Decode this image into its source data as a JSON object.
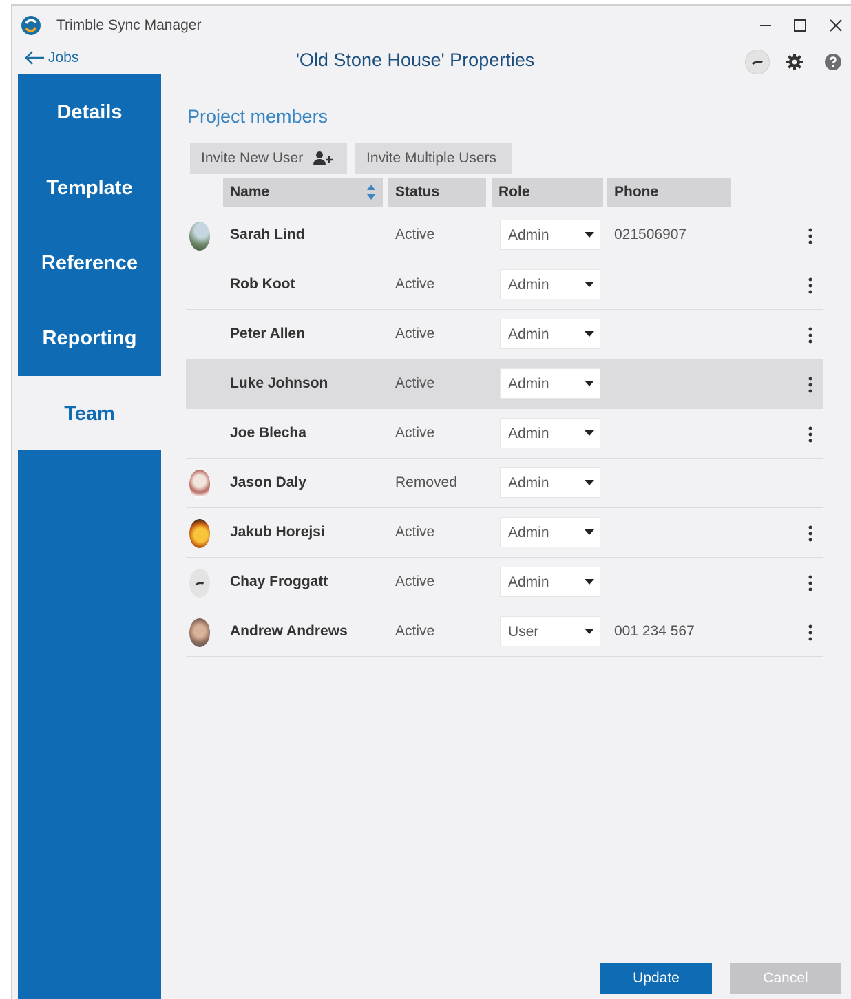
{
  "window": {
    "app_title": "Trimble Sync Manager",
    "back_label": "Jobs",
    "page_title": "'Old Stone House' Properties"
  },
  "colors": {
    "accent": "#0f6cb4",
    "sidebar_bg": "#0f6cb4",
    "content_bg": "#f2f2f4",
    "cancel_bg": "#c4c4c7"
  },
  "icons": [
    "app-logo-icon",
    "minimize-icon",
    "maximize-icon",
    "close-icon",
    "back-arrow-icon",
    "user-avatar-icon",
    "gear-icon",
    "help-icon",
    "add-user-icon",
    "sort-icon",
    "chevron-down-icon",
    "more-vertical-icon"
  ],
  "sidebar": {
    "items": [
      {
        "label": "Details",
        "active": false
      },
      {
        "label": "Template",
        "active": false
      },
      {
        "label": "Reference",
        "active": false
      },
      {
        "label": "Reporting",
        "active": false
      },
      {
        "label": "Team",
        "active": true
      }
    ]
  },
  "main": {
    "section_title": "Project members",
    "invite_new_user": "Invite New User",
    "invite_multiple_users": "Invite Multiple Users",
    "columns": {
      "name": "Name",
      "status": "Status",
      "role": "Role",
      "phone": "Phone"
    },
    "members": [
      {
        "name": "Sarah Lind",
        "status": "Active",
        "role": "Admin",
        "phone": "021506907",
        "has_avatar": true,
        "menu": true
      },
      {
        "name": "Rob Koot",
        "status": "Active",
        "role": "Admin",
        "phone": "",
        "has_avatar": false,
        "menu": true
      },
      {
        "name": "Peter Allen",
        "status": "Active",
        "role": "Admin",
        "phone": "",
        "has_avatar": false,
        "menu": true
      },
      {
        "name": "Luke Johnson",
        "status": "Active",
        "role": "Admin",
        "phone": "",
        "has_avatar": false,
        "menu": true,
        "highlighted": true
      },
      {
        "name": "Joe Blecha",
        "status": "Active",
        "role": "Admin",
        "phone": "",
        "has_avatar": false,
        "menu": true
      },
      {
        "name": "Jason Daly",
        "status": "Removed",
        "role": "Admin",
        "phone": "",
        "has_avatar": true,
        "menu": false
      },
      {
        "name": "Jakub Horejsi",
        "status": "Active",
        "role": "Admin",
        "phone": "",
        "has_avatar": true,
        "menu": true
      },
      {
        "name": "Chay Froggatt",
        "status": "Active",
        "role": "Admin",
        "phone": "",
        "has_avatar": true,
        "menu": true
      },
      {
        "name": "Andrew Andrews",
        "status": "Active",
        "role": "User",
        "phone": "001 234 567",
        "has_avatar": true,
        "menu": true
      }
    ]
  },
  "footer": {
    "update_label": "Update",
    "cancel_label": "Cancel"
  }
}
